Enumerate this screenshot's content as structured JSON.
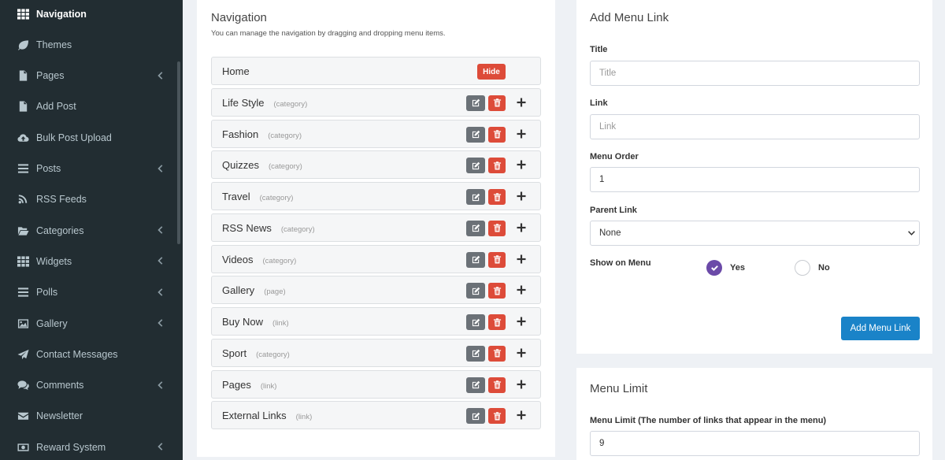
{
  "sidebar": {
    "items": [
      {
        "label": "Navigation",
        "icon": "grid-icon",
        "active": true,
        "chevron": false
      },
      {
        "label": "Themes",
        "icon": "leaf-icon",
        "active": false,
        "chevron": false
      },
      {
        "label": "Pages",
        "icon": "file-icon",
        "active": false,
        "chevron": true
      },
      {
        "label": "Add Post",
        "icon": "file-icon",
        "active": false,
        "chevron": false
      },
      {
        "label": "Bulk Post Upload",
        "icon": "cloud-upload-icon",
        "active": false,
        "chevron": false
      },
      {
        "label": "Posts",
        "icon": "list-icon",
        "active": false,
        "chevron": true
      },
      {
        "label": "RSS Feeds",
        "icon": "rss-icon",
        "active": false,
        "chevron": false
      },
      {
        "label": "Categories",
        "icon": "folder-open-icon",
        "active": false,
        "chevron": true
      },
      {
        "label": "Widgets",
        "icon": "grid-icon",
        "active": false,
        "chevron": true
      },
      {
        "label": "Polls",
        "icon": "list-icon",
        "active": false,
        "chevron": true
      },
      {
        "label": "Gallery",
        "icon": "image-icon",
        "active": false,
        "chevron": true
      },
      {
        "label": "Contact Messages",
        "icon": "paper-plane-icon",
        "active": false,
        "chevron": false
      },
      {
        "label": "Comments",
        "icon": "comments-icon",
        "active": false,
        "chevron": true
      },
      {
        "label": "Newsletter",
        "icon": "envelope-icon",
        "active": false,
        "chevron": false
      },
      {
        "label": "Reward System",
        "icon": "money-icon",
        "active": false,
        "chevron": true
      }
    ]
  },
  "navigation": {
    "title": "Navigation",
    "subtitle": "You can manage the navigation by dragging and dropping menu items.",
    "hide_label": "Hide",
    "items": [
      {
        "name": "Home",
        "type": ""
      },
      {
        "name": "Life Style",
        "type": "(category)"
      },
      {
        "name": "Fashion",
        "type": "(category)"
      },
      {
        "name": "Quizzes",
        "type": "(category)"
      },
      {
        "name": "Travel",
        "type": "(category)"
      },
      {
        "name": "RSS News",
        "type": "(category)"
      },
      {
        "name": "Videos",
        "type": "(category)"
      },
      {
        "name": "Gallery",
        "type": "(page)"
      },
      {
        "name": "Buy Now",
        "type": "(link)"
      },
      {
        "name": "Sport",
        "type": "(category)"
      },
      {
        "name": "Pages",
        "type": "(link)"
      },
      {
        "name": "External Links",
        "type": "(link)"
      }
    ]
  },
  "add_menu": {
    "title": "Add Menu Link",
    "title_label": "Title",
    "title_placeholder": "Title",
    "link_label": "Link",
    "link_placeholder": "Link",
    "order_label": "Menu Order",
    "order_value": "1",
    "parent_label": "Parent Link",
    "parent_value": "None",
    "show_label": "Show on Menu",
    "yes_label": "Yes",
    "no_label": "No",
    "submit_label": "Add Menu Link"
  },
  "menu_limit": {
    "title": "Menu Limit",
    "label": "Menu Limit (The number of links that appear in the menu)",
    "value": "9"
  },
  "colors": {
    "sidebar_bg": "#222d32",
    "danger": "#dd4b39",
    "primary": "#1a83c8",
    "radio_checked": "#6b4aa8"
  }
}
